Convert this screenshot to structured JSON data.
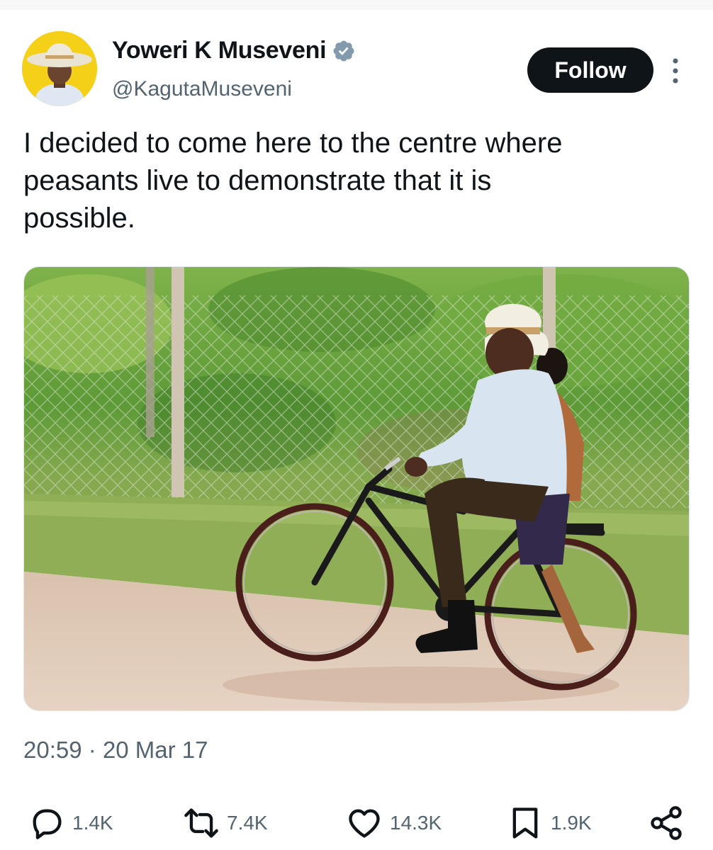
{
  "author": {
    "display_name": "Yoweri K Museveni",
    "handle": "@KagutaMuseveni",
    "verified": true,
    "avatar": "avatar-man-in-white-hat"
  },
  "follow_label": "Follow",
  "tweet": {
    "text_lines": [
      "I decided to come here to the centre where",
      "peasants live to demonstrate that it is",
      "possible."
    ],
    "image": "photo-man-riding-black-bicycle-on-dirt-road"
  },
  "meta": {
    "time": "20:59",
    "separator": "·",
    "date": "20 Mar 17"
  },
  "actions": {
    "replies": "1.4K",
    "reposts": "7.4K",
    "likes": "14.3K",
    "bookmarks": "1.9K"
  },
  "colors": {
    "text": "#0f1419",
    "secondary": "#536471",
    "verified": "#829aab",
    "follow_bg": "#0f1419"
  },
  "icons": [
    "verified-badge-icon",
    "more-options-icon",
    "reply-icon",
    "repost-icon",
    "like-icon",
    "bookmark-icon",
    "share-icon"
  ]
}
